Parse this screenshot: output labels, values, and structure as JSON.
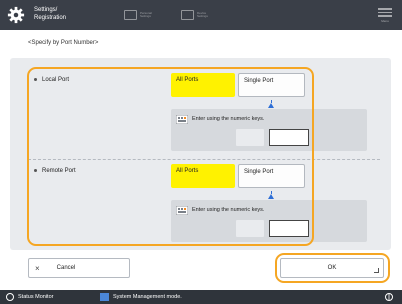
{
  "header": {
    "title_line1": "Settings/",
    "title_line2": "Registration",
    "tab1_label": "Personal Settings",
    "tab2_label": "Device Settings",
    "menu_label": "Menu"
  },
  "subtitle": "<Specify by Port Number>",
  "local": {
    "label": "Local Port",
    "all_label": "All Ports",
    "single_label": "Single Port",
    "note": "Enter using the numeric keys.",
    "value": ""
  },
  "remote": {
    "label": "Remote Port",
    "all_label": "All Ports",
    "single_label": "Single Port",
    "note": "Enter using the numeric keys.",
    "value": ""
  },
  "footer": {
    "cancel_label": "Cancel",
    "ok_label": "OK"
  },
  "status": {
    "monitor_label": "Status Monitor",
    "mode_label": "System Management mode."
  },
  "colors": {
    "accent": "#f5a623",
    "selected": "#fff200",
    "header_bg": "#3a3f48"
  },
  "icons": [
    "gear-icon",
    "personal-settings-icon",
    "device-settings-icon",
    "menu-icon",
    "keyboard-icon",
    "arrow-up-icon",
    "close-icon",
    "corner-icon",
    "status-monitor-icon",
    "system-mode-icon",
    "network-icon"
  ]
}
